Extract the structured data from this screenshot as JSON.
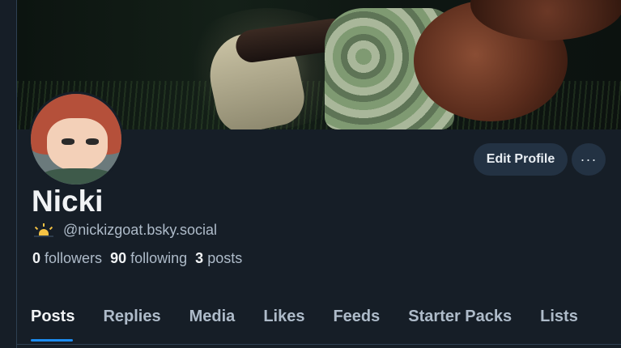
{
  "profile": {
    "display_name": "Nicki",
    "handle": "@nickizgoat.bsky.social",
    "handle_emoji": "sunrise-icon"
  },
  "stats": {
    "followers_count": "0",
    "followers_label": "followers",
    "following_count": "90",
    "following_label": "following",
    "posts_count": "3",
    "posts_label": "posts"
  },
  "actions": {
    "edit_label": "Edit Profile",
    "more_label": "···"
  },
  "tabs": [
    {
      "label": "Posts",
      "active": true
    },
    {
      "label": "Replies"
    },
    {
      "label": "Media"
    },
    {
      "label": "Likes"
    },
    {
      "label": "Feeds"
    },
    {
      "label": "Starter Packs"
    },
    {
      "label": "Lists"
    }
  ],
  "colors": {
    "background": "#161e27",
    "button_bg": "#233243",
    "accent": "#1d8cf0",
    "muted_text": "#aebbc9"
  }
}
